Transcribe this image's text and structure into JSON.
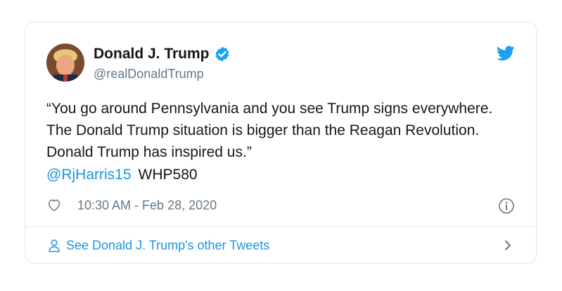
{
  "author": {
    "display_name": "Donald J. Trump",
    "handle": "@realDonaldTrump",
    "avatar_icon": "profile-photo",
    "verified": true
  },
  "tweet": {
    "text": "“You go around Pennsylvania and you see Trump signs everywhere. The Donald Trump situation is bigger than the Reagan Revolution. Donald Trump has inspired us.”",
    "mention": "@RjHarris15",
    "tag": "WHP580",
    "timestamp": "10:30 AM - Feb 28, 2020"
  },
  "footer": {
    "link_label": "See Donald J. Trump's other Tweets"
  },
  "colors": {
    "link": "#1b95e0",
    "twitter_blue": "#1da1f2",
    "muted": "#657786",
    "border": "#e1e8ed"
  }
}
